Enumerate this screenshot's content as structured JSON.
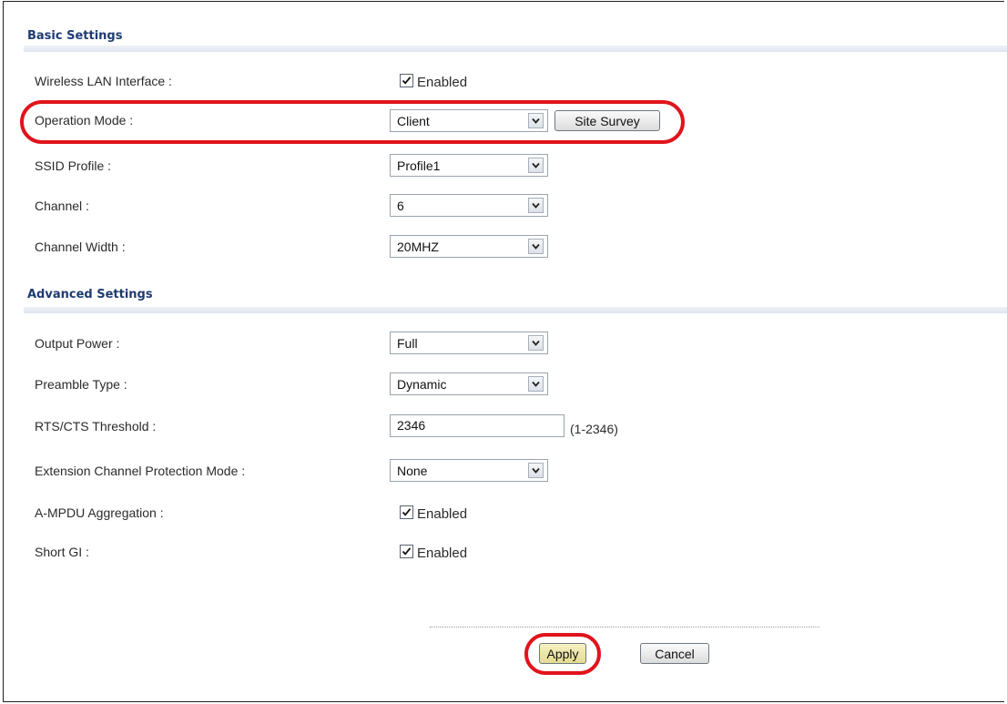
{
  "colors": {
    "section_title": "#1f3b73",
    "highlight": "#e0141c",
    "apply_button": "#ece6a8"
  },
  "basic": {
    "title": "Basic Settings",
    "wlan_label": "Wireless LAN Interface :",
    "wlan_check": "Enabled",
    "opmode_label": "Operation Mode :",
    "opmode_value": "Client",
    "site_survey": "Site Survey",
    "ssid_label": "SSID Profile :",
    "ssid_value": "Profile1",
    "channel_label": "Channel :",
    "channel_value": "6",
    "width_label": "Channel Width :",
    "width_value": "20MHZ"
  },
  "advanced": {
    "title": "Advanced Settings",
    "power_label": "Output Power :",
    "power_value": "Full",
    "preamble_label": "Preamble Type :",
    "preamble_value": "Dynamic",
    "rts_label": "RTS/CTS Threshold :",
    "rts_value": "2346",
    "rts_hint": "(1-2346)",
    "ext_label": "Extension Channel Protection Mode :",
    "ext_value": "None",
    "ampdu_label": "A-MPDU Aggregation :",
    "ampdu_check": "Enabled",
    "gi_label": "Short GI :",
    "gi_check": "Enabled"
  },
  "actions": {
    "apply": "Apply",
    "cancel": "Cancel"
  }
}
